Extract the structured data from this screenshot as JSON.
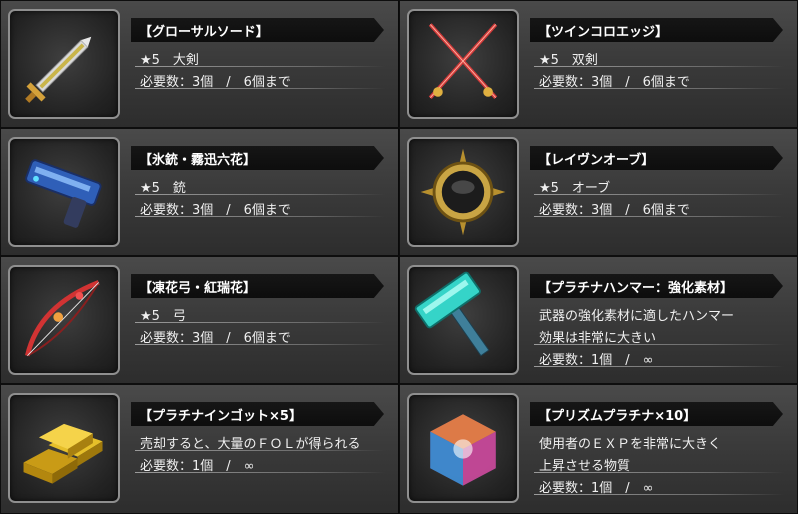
{
  "items": [
    {
      "name": "【グローサルソード】",
      "line1": "★5　大剣",
      "line2": "必要数：3個　/　6個まで",
      "icon": "greatsword-icon"
    },
    {
      "name": "【ツインコロエッジ】",
      "line1": "★5　双剣",
      "line2": "必要数：3個　/　6個まで",
      "icon": "twin-swords-icon"
    },
    {
      "name": "【氷銃・霧迅六花】",
      "line1": "★5　銃",
      "line2": "必要数：3個　/　6個まで",
      "icon": "gun-icon"
    },
    {
      "name": "【レイヴンオーブ】",
      "line1": "★5　オーブ",
      "line2": "必要数：3個　/　6個まで",
      "icon": "orb-icon"
    },
    {
      "name": "【凍花弓・紅瑞花】",
      "line1": "★5　弓",
      "line2": "必要数：3個　/　6個まで",
      "icon": "bow-icon"
    },
    {
      "name": "【プラチナハンマー：強化素材】",
      "line1": "武器の強化素材に適したハンマー",
      "line1b": "効果は非常に大きい",
      "line2": "必要数：1個　/　∞",
      "icon": "hammer-icon"
    },
    {
      "name": "【プラチナインゴット×5】",
      "line1": "売却すると、大量のＦＯＬが得られる",
      "line2": "必要数：1個　/　∞",
      "icon": "gold-ingot-icon"
    },
    {
      "name": "【プリズムプラチナ×10】",
      "line1": "使用者のＥＸＰを非常に大きく",
      "line1b": "上昇させる物質",
      "line2": "必要数：1個　/　∞",
      "icon": "prism-cube-icon"
    }
  ]
}
